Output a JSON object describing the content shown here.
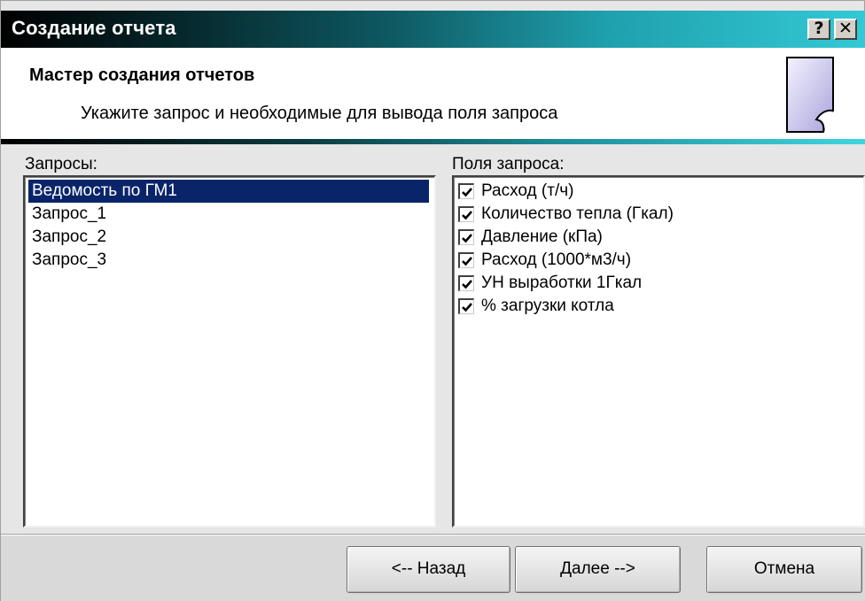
{
  "window": {
    "title": "Создание отчета",
    "help_label": "?",
    "close_label": "✕"
  },
  "header": {
    "title": "Мастер создания отчетов",
    "subtitle": "Укажите запрос и необходимые для вывода поля запроса",
    "icon": "document-icon"
  },
  "queries": {
    "label": "Запросы:",
    "items": [
      "Ведомость по ГМ1",
      "Запрос_1",
      "Запрос_2",
      "Запрос_3"
    ],
    "selected": "Ведомость по ГМ1"
  },
  "fields": {
    "label": "Поля запроса:",
    "items": [
      {
        "label": "Расход (т/ч)",
        "checked": true
      },
      {
        "label": "Количество тепла (Гкал)",
        "checked": true
      },
      {
        "label": "Давление (кПа)",
        "checked": true
      },
      {
        "label": "Расход (1000*м3/ч)",
        "checked": true
      },
      {
        "label": "УН выработки 1Гкал",
        "checked": true
      },
      {
        "label": "% загрузки котла",
        "checked": true
      }
    ]
  },
  "buttons": {
    "back": "<-- Назад",
    "next": "Далее -->",
    "cancel": "Отмена"
  },
  "colors": {
    "selection": "#0a246a",
    "title_gradient_start": "#000000",
    "title_gradient_end": "#34c9d6"
  }
}
